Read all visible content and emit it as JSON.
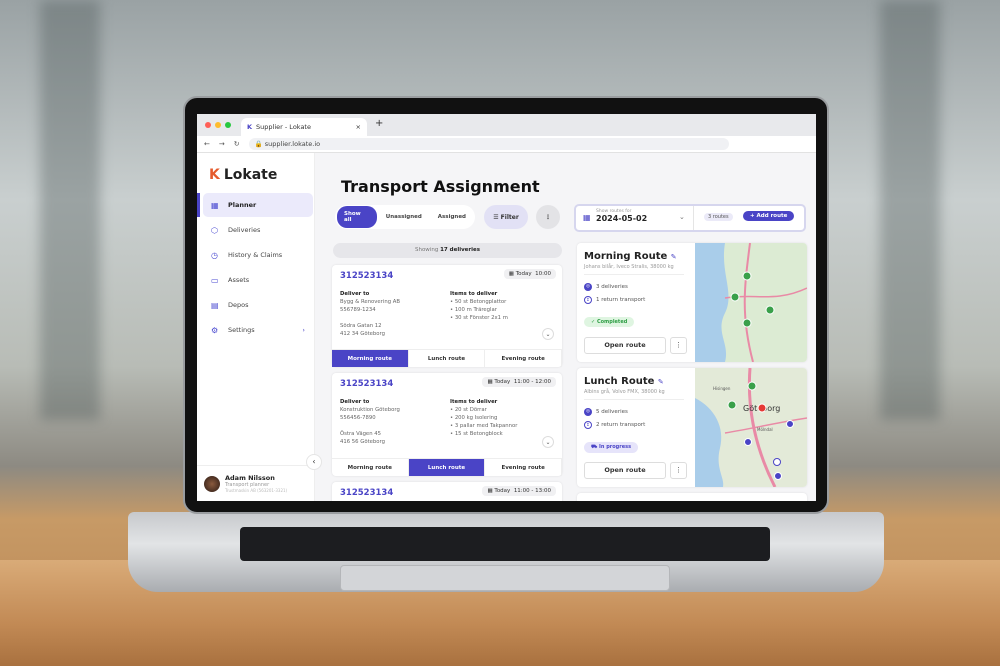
{
  "browser": {
    "tab_title": "Supplier - Lokate",
    "url": "supplier.lokate.io",
    "close": "×",
    "new_tab": "+"
  },
  "sidebar": {
    "logo": "Lokate",
    "items": [
      {
        "label": "Planner",
        "icon": "calendar-icon"
      },
      {
        "label": "Deliveries",
        "icon": "box-icon"
      },
      {
        "label": "History & Claims",
        "icon": "history-icon"
      },
      {
        "label": "Assets",
        "icon": "truck-icon"
      },
      {
        "label": "Depos",
        "icon": "store-icon"
      },
      {
        "label": "Settings",
        "icon": "gear-icon"
      }
    ],
    "user": {
      "name": "Adam Nilsson",
      "role": "Transport planner",
      "company": "Trustmaskin AB (563201-3321)"
    }
  },
  "main": {
    "title": "Transport Assignment",
    "filters": [
      "Show all",
      "Unassigned",
      "Assigned"
    ],
    "filter_button": "Filter",
    "showing_prefix": "Showing",
    "showing_count": "17 deliveries",
    "deliveries": [
      {
        "id": "312523134",
        "day": "Today",
        "time": "10:00",
        "deliver_to_label": "Deliver to",
        "company": "Bygg & Renovering AB",
        "org": "556789-1234",
        "street": "Södra Gatan 12",
        "city": "412 34 Göteborg",
        "items_label": "Items to deliver",
        "items": [
          "50 st Betongplattor",
          "100 m Träreglar",
          "30 st Fönster 2x1 m"
        ],
        "selected": "Morning route"
      },
      {
        "id": "312523134",
        "day": "Today",
        "time": "11:00 - 12:00",
        "deliver_to_label": "Deliver to",
        "company": "Konstruktion Göteborg",
        "org": "556456-7890",
        "street": "Östra Vägen 45",
        "city": "416 56 Göteborg",
        "items_label": "Items to deliver",
        "items": [
          "20 st Dörrar",
          "200 kg Isolering",
          "3 pallar med Takpannor",
          "15 st Betongblock"
        ],
        "selected": "Lunch route"
      },
      {
        "id": "312523134",
        "day": "Today",
        "time": "11:00 - 13:00"
      }
    ],
    "route_options": [
      "Morning route",
      "Lunch route",
      "Evening route"
    ]
  },
  "routes_panel": {
    "date_label": "Show routes for",
    "date": "2024-05-02",
    "count": "3 routes",
    "add_label": "Add route",
    "routes": [
      {
        "name": "Morning Route",
        "vehicle": "Johans bilår, Iveco Stralis, 38000 kg",
        "deliveries": "3 deliveries",
        "returns": "1 return transport",
        "status": "Completed",
        "status_color": "#dff5e1",
        "open": "Open route"
      },
      {
        "name": "Lunch Route",
        "vehicle": "Albins grå, Volvo FMX, 38000 kg",
        "deliveries": "5 deliveries",
        "returns": "2 return transport",
        "status": "In progress",
        "status_color": "#e6e4fa",
        "open": "Open route"
      }
    ],
    "map_labels": [
      "Göteborg",
      "Hisingen",
      "Mölndal"
    ]
  },
  "colors": {
    "accent": "#4a44c6",
    "completed": "#2e9e44"
  }
}
